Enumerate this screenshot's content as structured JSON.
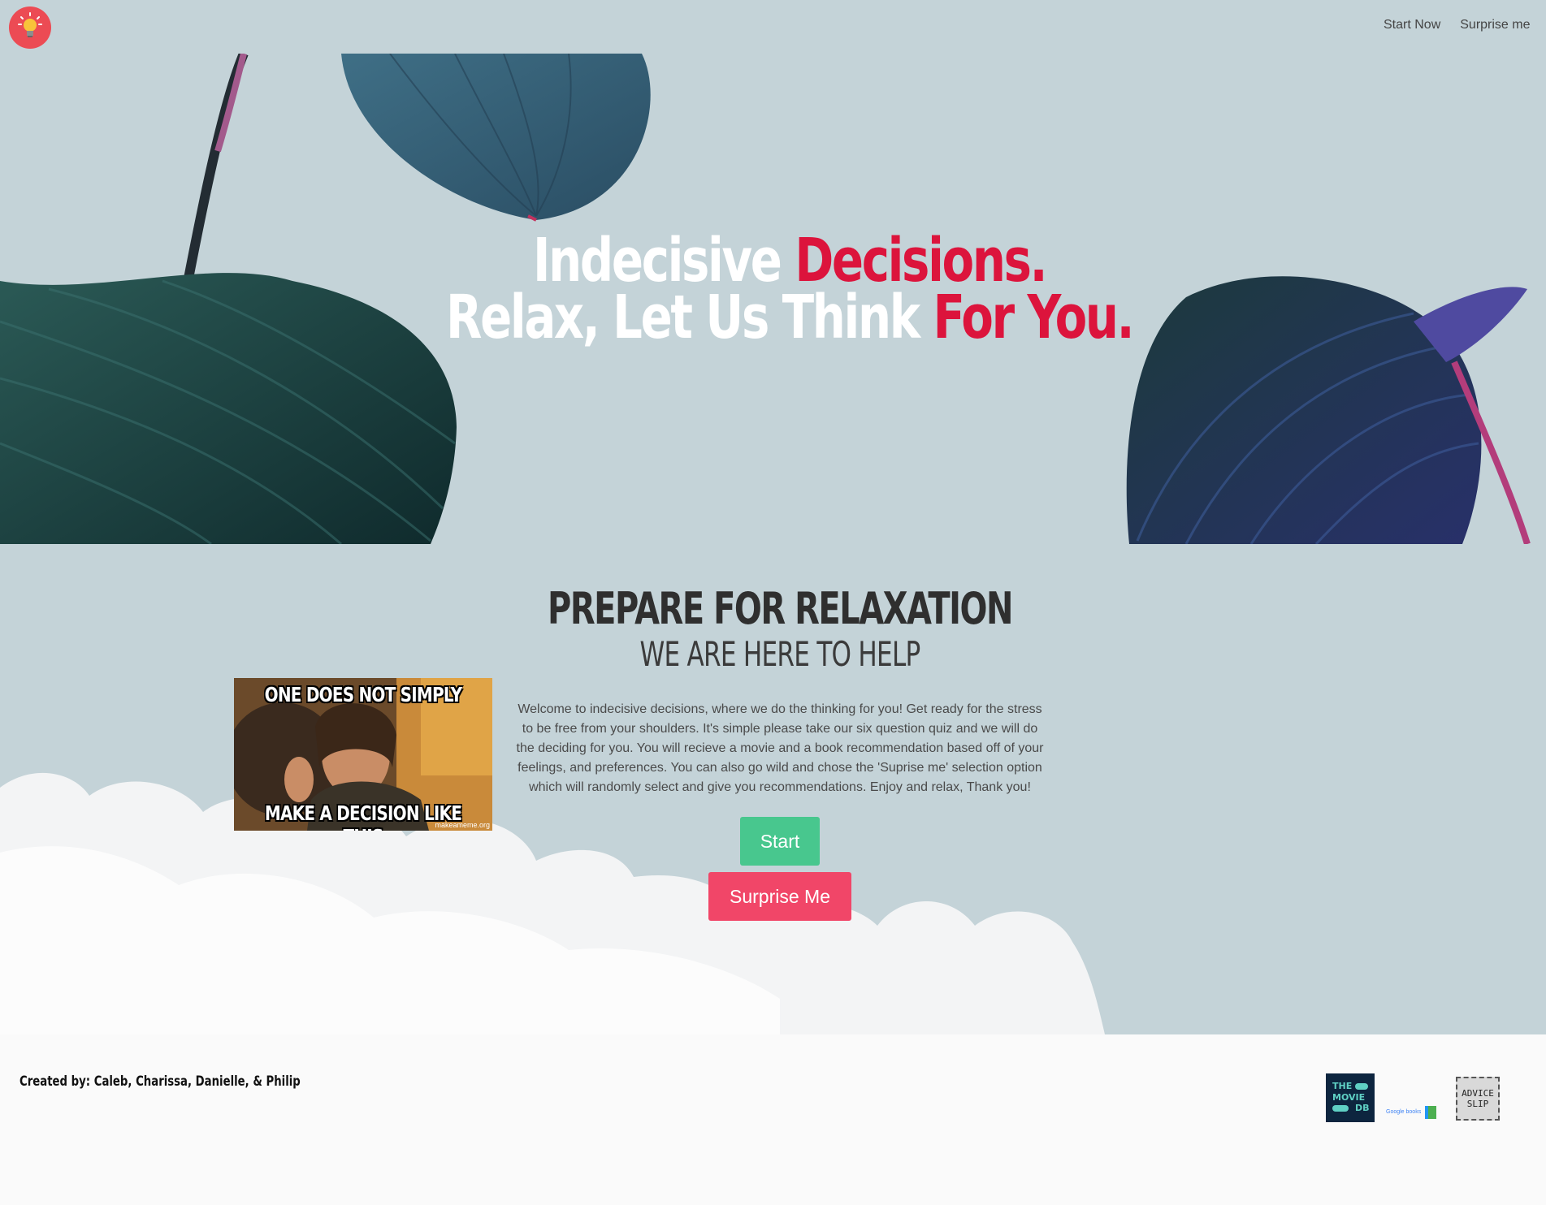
{
  "nav": {
    "logo_icon": "lightbulb-icon",
    "links": [
      "Start Now",
      "Surprise me"
    ]
  },
  "hero": {
    "line1_white": "Indecisive",
    "line1_red": "Decisions.",
    "line2_white": "Relax, Let Us Think",
    "line2_red": "For You."
  },
  "main": {
    "title": "PREPARE FOR RELAXATION",
    "subtitle": "WE ARE HERE TO HELP",
    "meme": {
      "top_text": "ONE DOES NOT SIMPLY",
      "bottom_text": "MAKE A DECISION LIKE THIS",
      "credit": "makeameme.org"
    },
    "intro": "Welcome to indecisive decisions, where we do the thinking for you! Get ready for the stress to be free from your shoulders. It's simple please take our six question quiz and we will do the deciding for you. You will recieve a movie and a book recommendation based off of your feelings, and preferences. You can also go wild and chose the 'Suprise me' selection option which will randomly select and give you recommendations. Enjoy and relax, Thank you!",
    "start_label": "Start",
    "surprise_label": "Surprise Me"
  },
  "footer": {
    "credits": "Created by: Caleb, Charissa, Danielle, & Philip",
    "tmdb_l1": "THE",
    "tmdb_l2": "MOVIE",
    "tmdb_l3": "DB",
    "gbooks": "Google books",
    "advice_l1": "ADVICE",
    "advice_l2": "SLIP"
  },
  "colors": {
    "background": "#c4d3d8",
    "accent_red": "#dc143c",
    "start_green": "#48c78e",
    "surprise_pink": "#f14668",
    "logo_red": "#ec4b54"
  }
}
